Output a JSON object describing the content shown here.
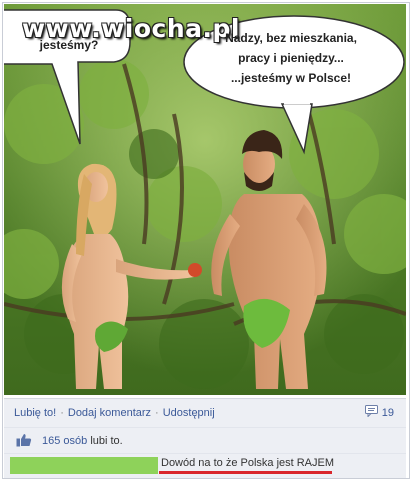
{
  "image": {
    "watermark": "www.wiocha.pl",
    "bubble_left": "jesteśmy?",
    "bubble_right": [
      "Nadzy, bez mieszkania,",
      "pracy i pieniędzy...",
      "...jesteśmy w Polsce!"
    ]
  },
  "actions": {
    "like": "Lubię to!",
    "comment": "Dodaj komentarz",
    "share": "Udostępnij",
    "comments_count": "19"
  },
  "likes": {
    "count_text": "165 osób",
    "rest": " lubi to."
  },
  "comment": {
    "text": "Dowód na to że Polska jest RAJEM"
  },
  "colors": {
    "facebook_link": "#3b5998",
    "facebook_bg": "#edeff4",
    "underline": "#d9262b",
    "avatar": "#8ed25a"
  }
}
